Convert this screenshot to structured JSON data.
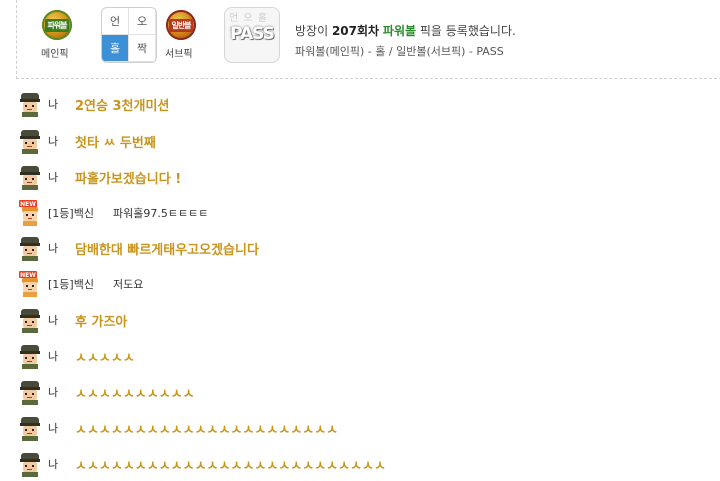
{
  "pick": {
    "main_ball_label": "파워볼",
    "main_caption": "메인픽",
    "grid": [
      {
        "text": "언",
        "selected": false
      },
      {
        "text": "오",
        "selected": false
      },
      {
        "text": "홀",
        "selected": true
      },
      {
        "text": "짝",
        "selected": false
      }
    ],
    "sub_ball_label": "일반볼",
    "sub_caption": "서브픽",
    "pass_label": "PASS",
    "pass_bg": "언 오 홀 짝",
    "announce_prefix": "방장이 ",
    "round": "207회차",
    "game": "파워볼",
    "announce_suffix": " 픽을 등록했습니다.",
    "detail": "파워볼(메인픽) - 홀 / 일반볼(서브픽) - PASS"
  },
  "messages": [
    {
      "nick": "나",
      "text": "2연승 3천개미션",
      "type": "me"
    },
    {
      "nick": "나",
      "text": "첫타 ㅆ 두번째",
      "type": "me"
    },
    {
      "nick": "나",
      "text": "파홀가보겠습니다 !",
      "type": "me"
    },
    {
      "nick": "[1등]백신",
      "text": "파워홀97.5ㅌㅌㅌㅌ",
      "type": "other"
    },
    {
      "nick": "나",
      "text": "담배한대 빠르게태우고오겠습니다",
      "type": "me"
    },
    {
      "nick": "[1등]백신",
      "text": "저도요",
      "type": "other"
    },
    {
      "nick": "나",
      "text": "후 가즈아",
      "type": "me"
    },
    {
      "nick": "나",
      "text": "ㅅㅅㅅㅅㅅ",
      "type": "me"
    },
    {
      "nick": "나",
      "text": "ㅅㅅㅅㅅㅅㅅㅅㅅㅅㅅ",
      "type": "me"
    },
    {
      "nick": "나",
      "text": "ㅅㅅㅅㅅㅅㅅㅅㅅㅅㅅㅅㅅㅅㅅㅅㅅㅅㅅㅅㅅㅅㅅ",
      "type": "me"
    },
    {
      "nick": "나",
      "text": "ㅅㅅㅅㅅㅅㅅㅅㅅㅅㅅㅅㅅㅅㅅㅅㅅㅅㅅㅅㅅㅅㅅㅅㅅㅅㅅ",
      "type": "me"
    }
  ],
  "badge": "NEW",
  "colors": {
    "accent": "#c8951f",
    "selected": "#3d8fd6",
    "highlight": "#2e8b2e"
  }
}
